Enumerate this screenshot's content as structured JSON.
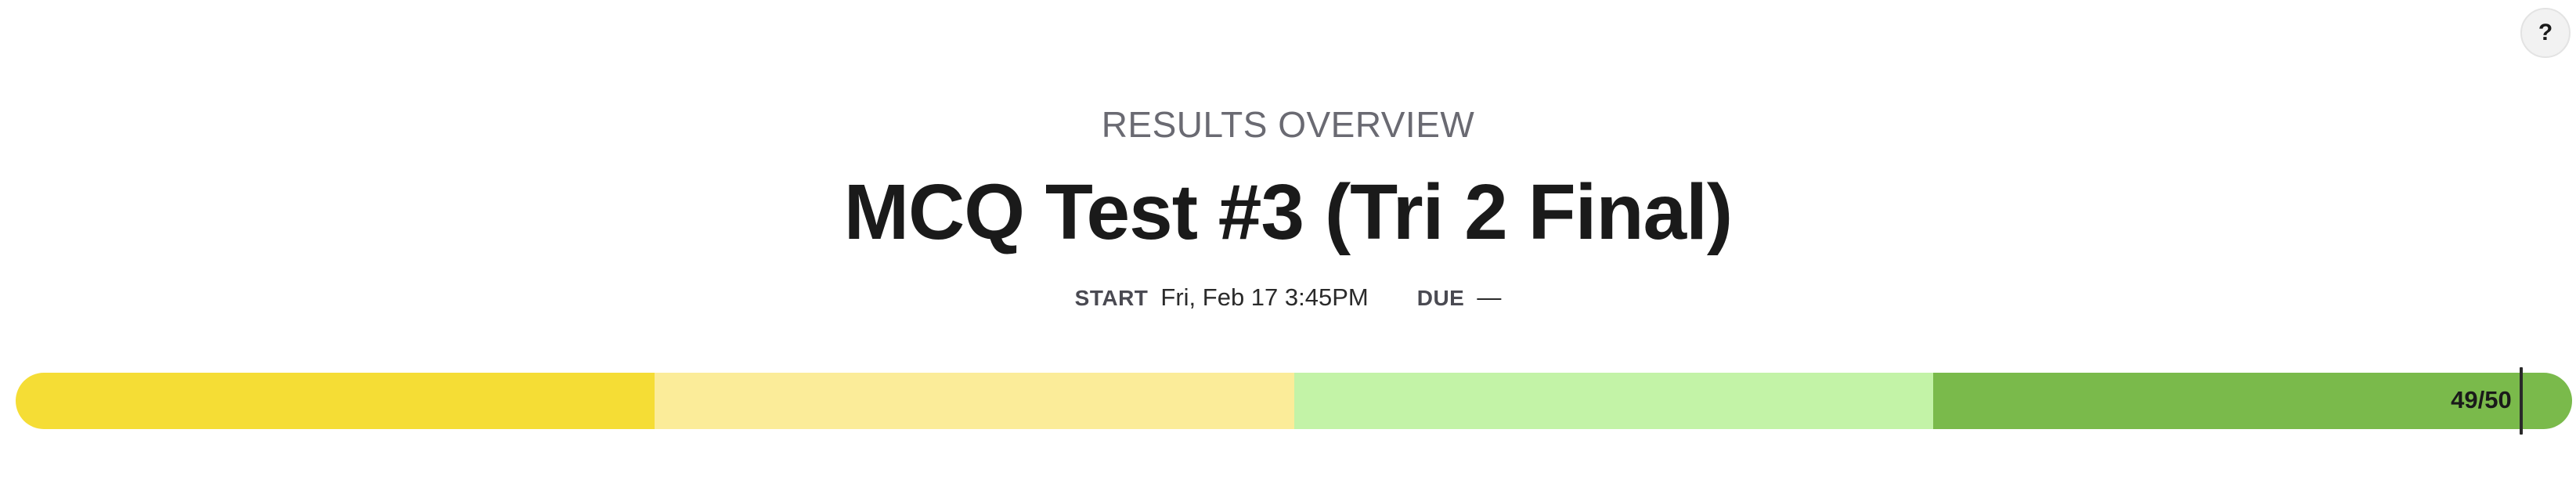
{
  "help": {
    "label": "?",
    "icon": "help-icon"
  },
  "header": {
    "overview_label": "RESULTS OVERVIEW",
    "title": "MCQ Test #3 (Tri 2 Final)"
  },
  "meta": {
    "start_label": "START",
    "start_value": "Fri, Feb 17 3:45PM",
    "due_label": "DUE",
    "due_value": "—"
  },
  "score": {
    "label": "49/50",
    "value": 49,
    "max": 50,
    "band_colors": [
      "#f5dd35",
      "#fbec99",
      "#c3f3a7",
      "#7aba4b"
    ]
  }
}
